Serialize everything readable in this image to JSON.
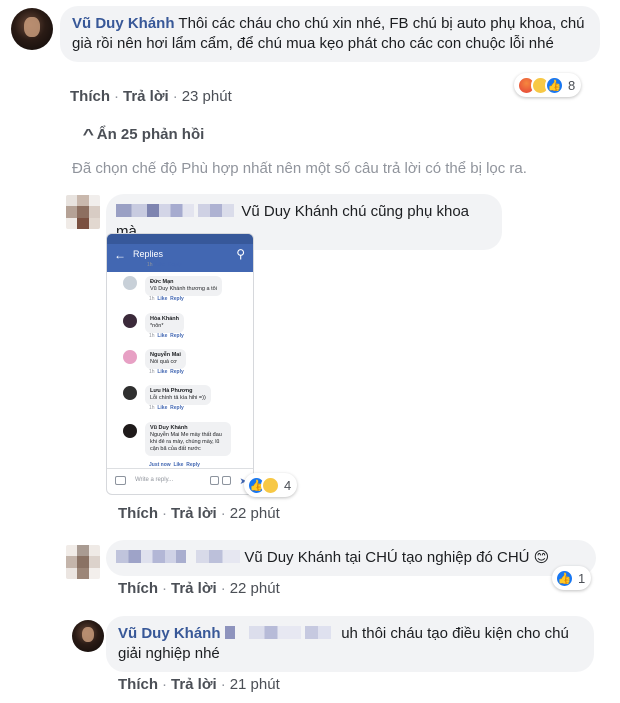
{
  "comment1": {
    "author": "Vũ Duy Khánh",
    "text": "Thôi các cháu cho chú xin nhé, FB chú bị auto phụ khoa, chú già rồi nên hơi lẩm cẩm, để chú mua kẹo phát cho các con chuộc lỗi nhé",
    "like": "Thích",
    "reply": "Trả lời",
    "time": "23 phút",
    "reaction_count": "8"
  },
  "hide_replies": "Ẩn 25 phản hồi",
  "filter_note": "Đã chọn chế độ Phù hợp nhất nên một số câu trả lời có thể bị lọc ra.",
  "reply1": {
    "text": "Vũ Duy Khánh chú cũng phụ khoa mà",
    "like": "Thích",
    "reply": "Trả lời",
    "time": "22 phút",
    "reaction_count": "4"
  },
  "screenshot": {
    "header_title": "Replies",
    "input_placeholder": "Write a reply...",
    "items": [
      {
        "name": "Đức Mạn",
        "text": "Vũ Duy Khánh  thương a tôi"
      },
      {
        "name": "Hòa Khánh",
        "text": "*nôn*"
      },
      {
        "name": "Nguyễn Mai",
        "text": "Nói quá cơ"
      },
      {
        "name": "Lưu Hà Phương",
        "text": "Lỗi chính tả kìa hihi =))"
      },
      {
        "name": "Vũ Duy Khánh",
        "text": "Nguyễn Mai Me mày thất đau khi đẻ ra mày, chúng mày, lũ cận bã của đất nước"
      }
    ],
    "action_like": "Like",
    "action_reply": "Reply",
    "action_time": "1h",
    "just_now": "Just now"
  },
  "reply2": {
    "text": "Vũ Duy Khánh tại CHÚ tạo nghiệp đó CHÚ 😊",
    "like": "Thích",
    "reply": "Trả lời",
    "time": "22 phút",
    "reaction_count": "1"
  },
  "reply3": {
    "author": "Vũ Duy Khánh",
    "text": "uh thôi cháu tạo điều kiện cho chú giải nghiệp nhé",
    "like": "Thích",
    "reply": "Trả lời",
    "time": "21 phút"
  },
  "colors": {
    "author_link": "#385898",
    "bubble_bg": "#f2f3f5",
    "like_blue": "#1877f2"
  }
}
